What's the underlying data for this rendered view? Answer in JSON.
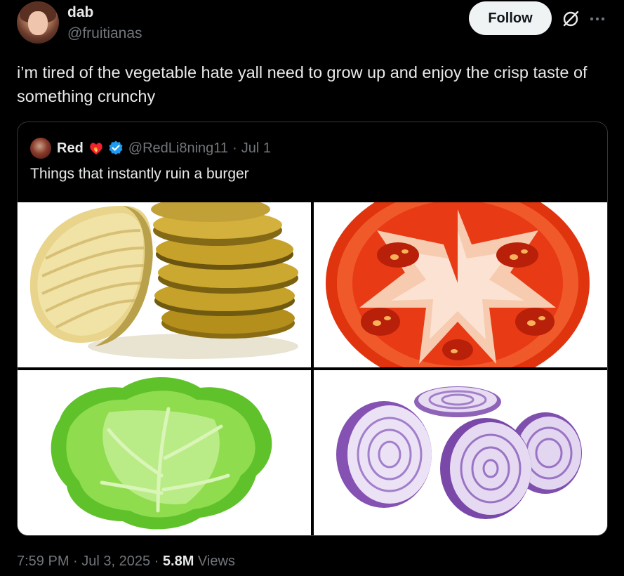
{
  "author": {
    "display_name": "dab",
    "handle": "@fruitianas"
  },
  "actions": {
    "follow_label": "Follow",
    "grok_icon": "grok-icon",
    "more_icon": "more-icon"
  },
  "tweet": {
    "text": "i’m tired of the vegetable hate yall need to grow up and enjoy the crisp taste of something crunchy"
  },
  "quoted": {
    "display_name": "Red",
    "handle": "@RedLi8ning11",
    "separator": "·",
    "date": "Jul 1",
    "text": "Things that instantly ruin a burger",
    "images": [
      "pickles",
      "tomato",
      "lettuce",
      "onion"
    ]
  },
  "meta": {
    "time": "7:59 PM",
    "sep1": " · ",
    "date": "Jul 3, 2025",
    "sep2": " · ",
    "views_count": "5.8M",
    "views_label": " Views"
  },
  "colors": {
    "background": "#000000",
    "text": "#e7e9ea",
    "secondary": "#71767b",
    "verified": "#1d9bf0",
    "border": "#333639"
  }
}
